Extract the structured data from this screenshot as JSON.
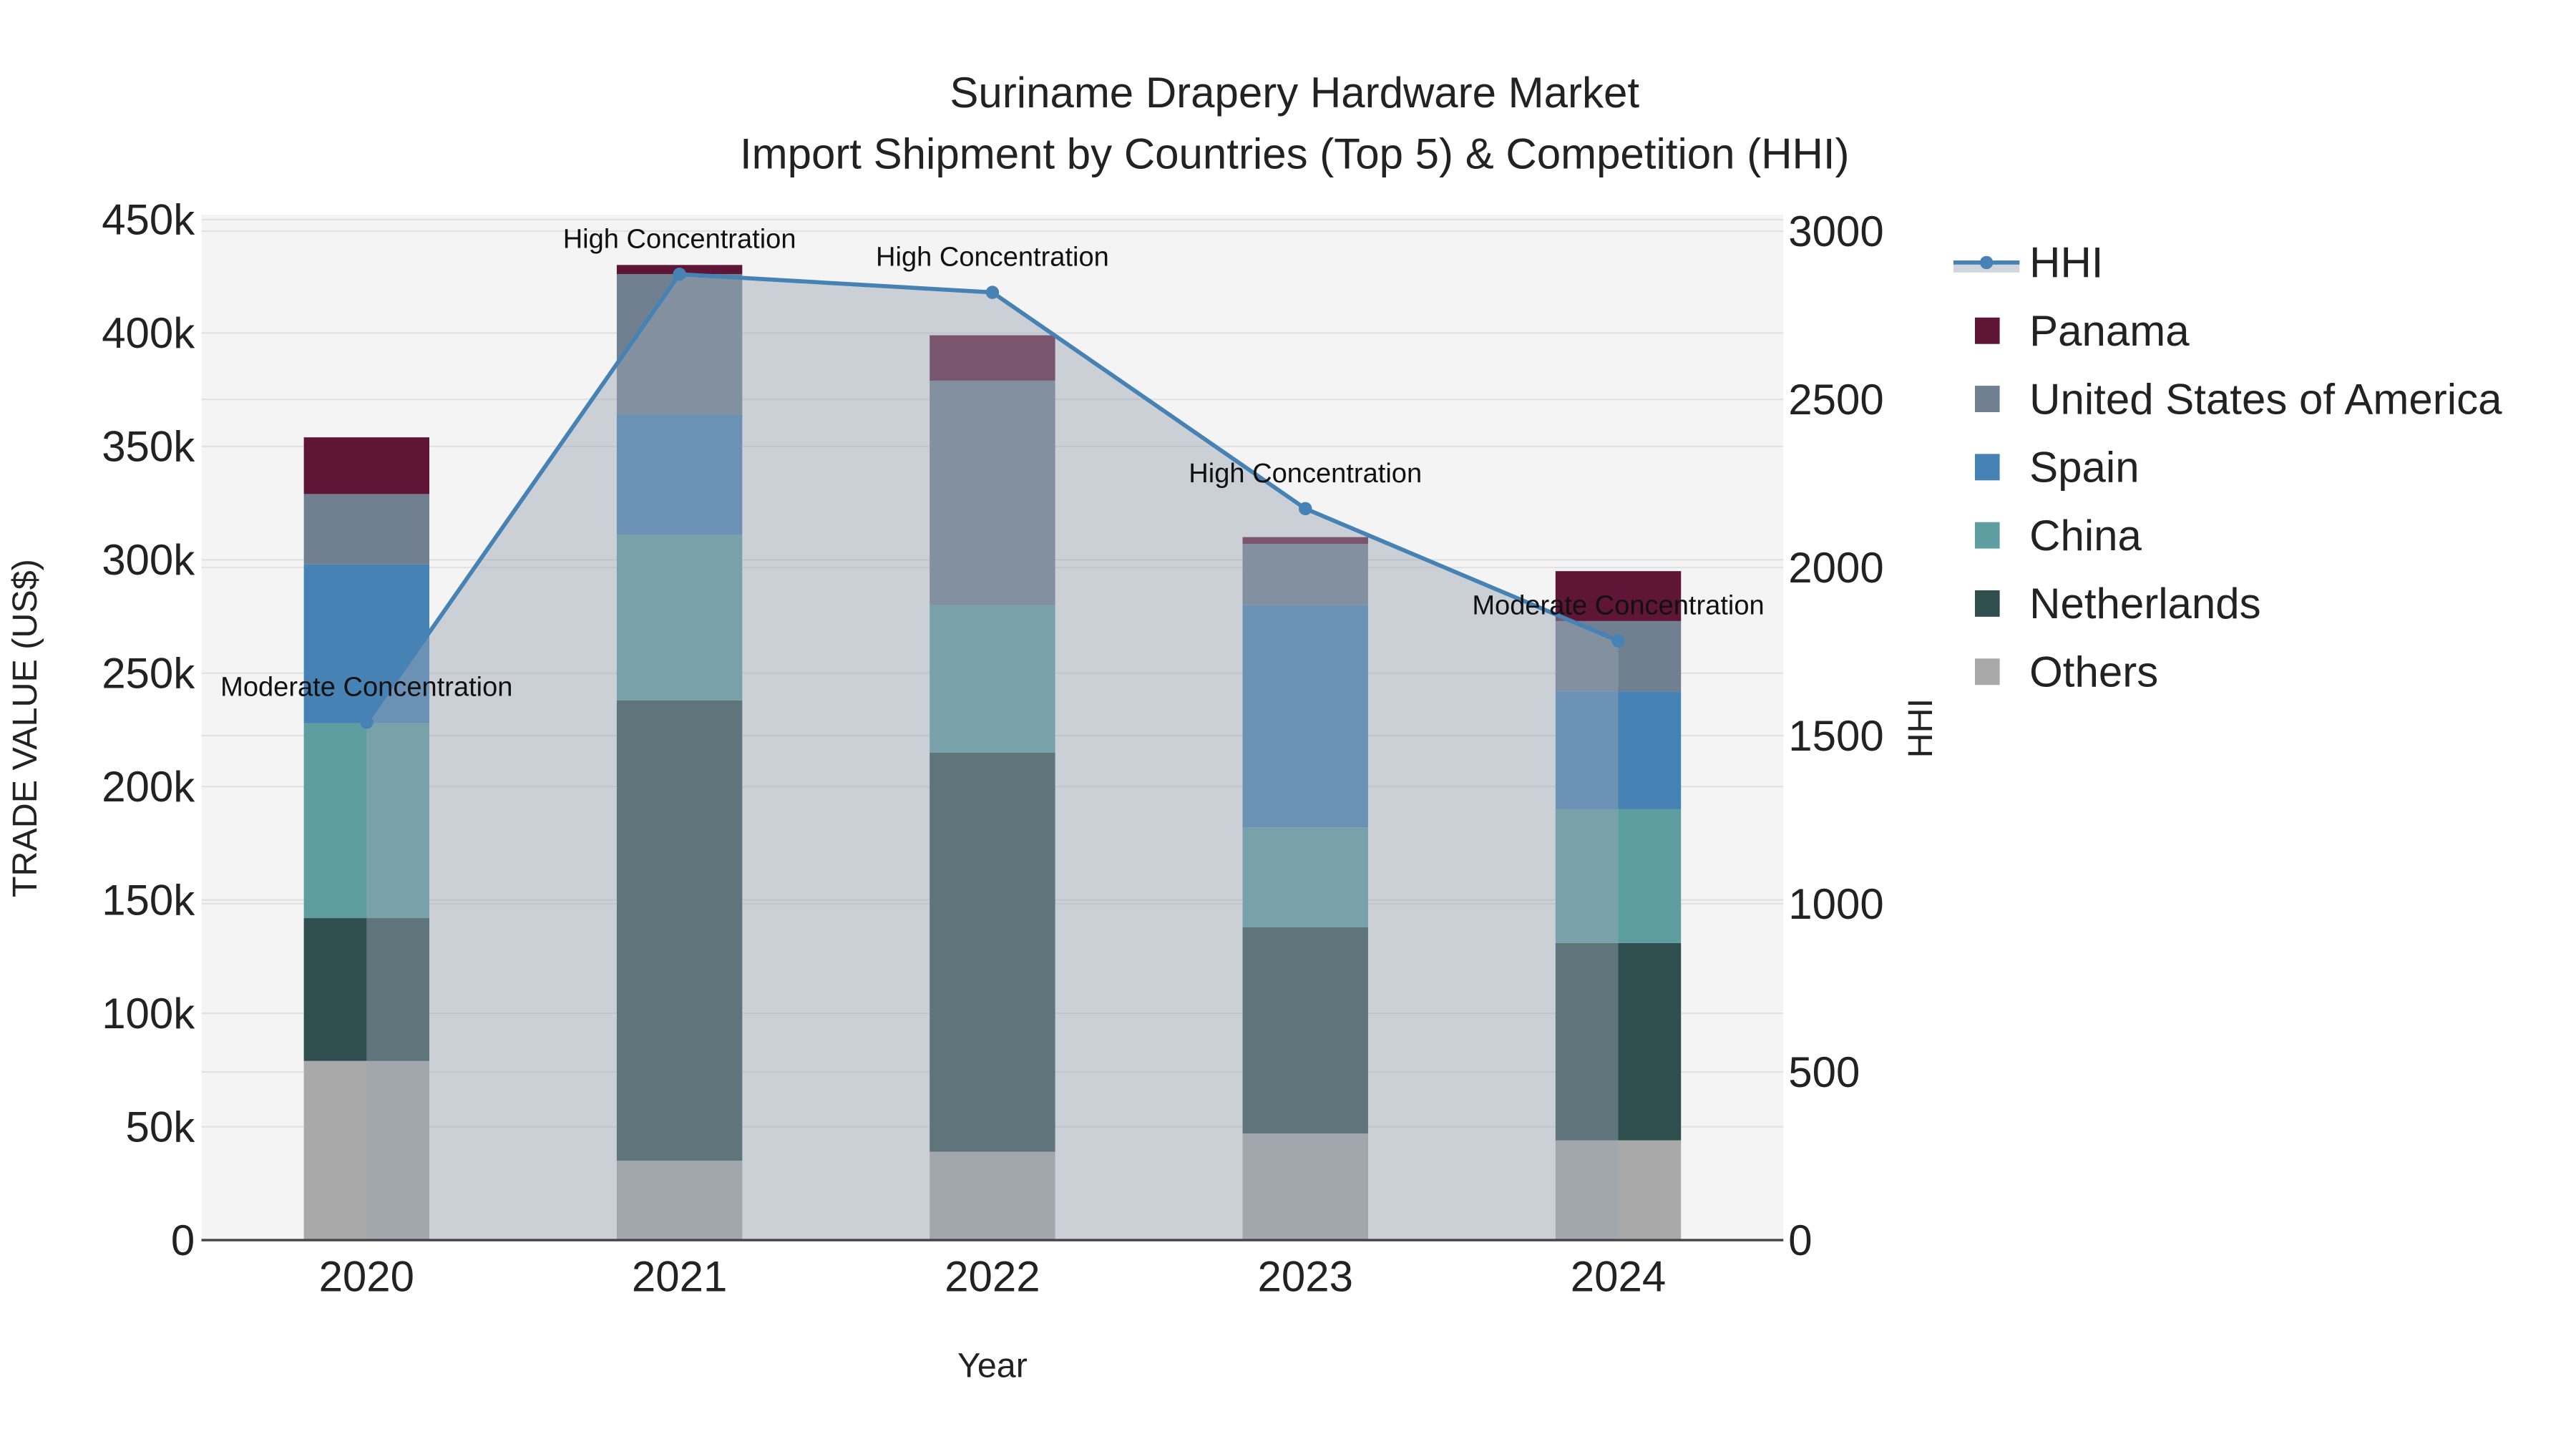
{
  "chart_data": {
    "type": "bar",
    "title_line1": "Suriname Drapery Hardware Market",
    "title_line2": "Import Shipment by Countries (Top 5) & Competition (HHI)",
    "xlabel": "Year",
    "ylabel": "TRADE VALUE (US$)",
    "y2label": "HHI",
    "categories": [
      "2020",
      "2021",
      "2022",
      "2023",
      "2024"
    ],
    "ylim": [
      0,
      450000
    ],
    "y2lim": [
      0,
      3000
    ],
    "yticks": [
      0,
      50000,
      100000,
      150000,
      200000,
      250000,
      300000,
      350000,
      400000,
      450000
    ],
    "ytick_labels": [
      "0",
      "50k",
      "100k",
      "150k",
      "200k",
      "250k",
      "300k",
      "350k",
      "400k",
      "450k"
    ],
    "y2ticks": [
      0,
      500,
      1000,
      1500,
      2000,
      2500,
      3000
    ],
    "y2tick_labels": [
      "0",
      "500",
      "1000",
      "1500",
      "2000",
      "2500",
      "3000"
    ],
    "stacking": "stacked",
    "series": [
      {
        "name": "Others",
        "color": "#a9a9a9",
        "values": [
          79000,
          35000,
          39000,
          47000,
          44000
        ]
      },
      {
        "name": "Netherlands",
        "color": "#2f4f4f",
        "values": [
          63000,
          203000,
          176000,
          91000,
          87000
        ]
      },
      {
        "name": "China",
        "color": "#5f9ea0",
        "values": [
          86000,
          73000,
          65000,
          44000,
          59000
        ]
      },
      {
        "name": "Spain",
        "color": "#4682b4",
        "values": [
          70000,
          53000,
          0,
          98000,
          52000
        ]
      },
      {
        "name": "United States of America",
        "color": "#708090",
        "values": [
          31000,
          62000,
          99000,
          27000,
          31000
        ]
      },
      {
        "name": "Panama",
        "color": "#5f1535",
        "values": [
          25000,
          4000,
          20000,
          3000,
          22000
        ]
      }
    ],
    "hhi": {
      "name": "HHI",
      "color": "#4682b4",
      "values": [
        1540,
        2872,
        2818,
        2175,
        1782
      ],
      "annotations": [
        "Moderate Concentration",
        "High Concentration",
        "High Concentration",
        "High Concentration",
        "Moderate Concentration"
      ]
    },
    "legend_order": [
      "HHI",
      "Panama",
      "United States of America",
      "Spain",
      "China",
      "Netherlands",
      "Others"
    ],
    "legend_position": "right",
    "grid": true
  }
}
